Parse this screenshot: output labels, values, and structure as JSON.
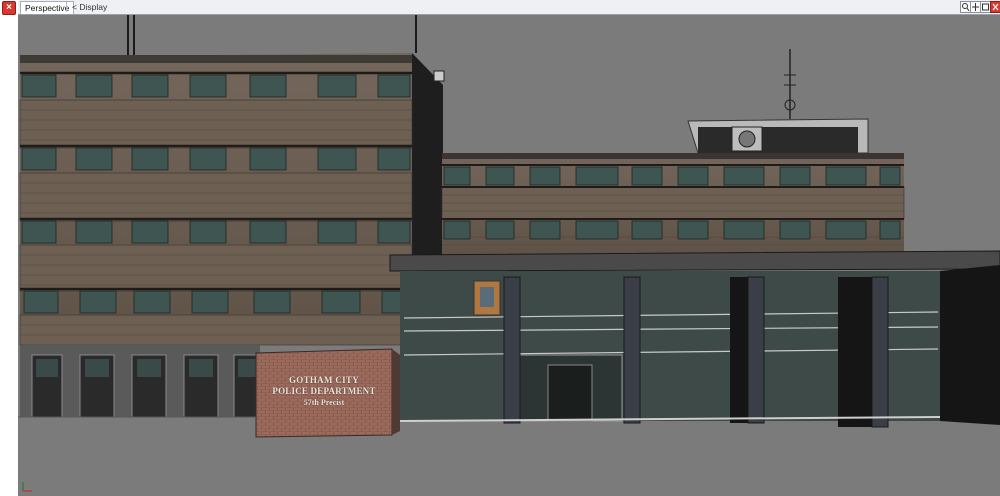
{
  "window": {
    "close_glyph": "×",
    "tabs": [
      {
        "label": "Perspective",
        "active": true
      },
      {
        "label": "< Display",
        "active": false
      }
    ],
    "controls": [
      "search-icon",
      "pan-icon",
      "maximize-icon",
      "close-icon"
    ]
  },
  "sign": {
    "line1": "GOTHAM CITY",
    "line2": "POLICE DEPARTMENT",
    "line3": "57th Precist"
  },
  "colors": {
    "viewport_bg": "#7b7b7b",
    "brick": "#8a5a4e",
    "glass": "#3e4a47",
    "wall": "#6e5f50"
  }
}
